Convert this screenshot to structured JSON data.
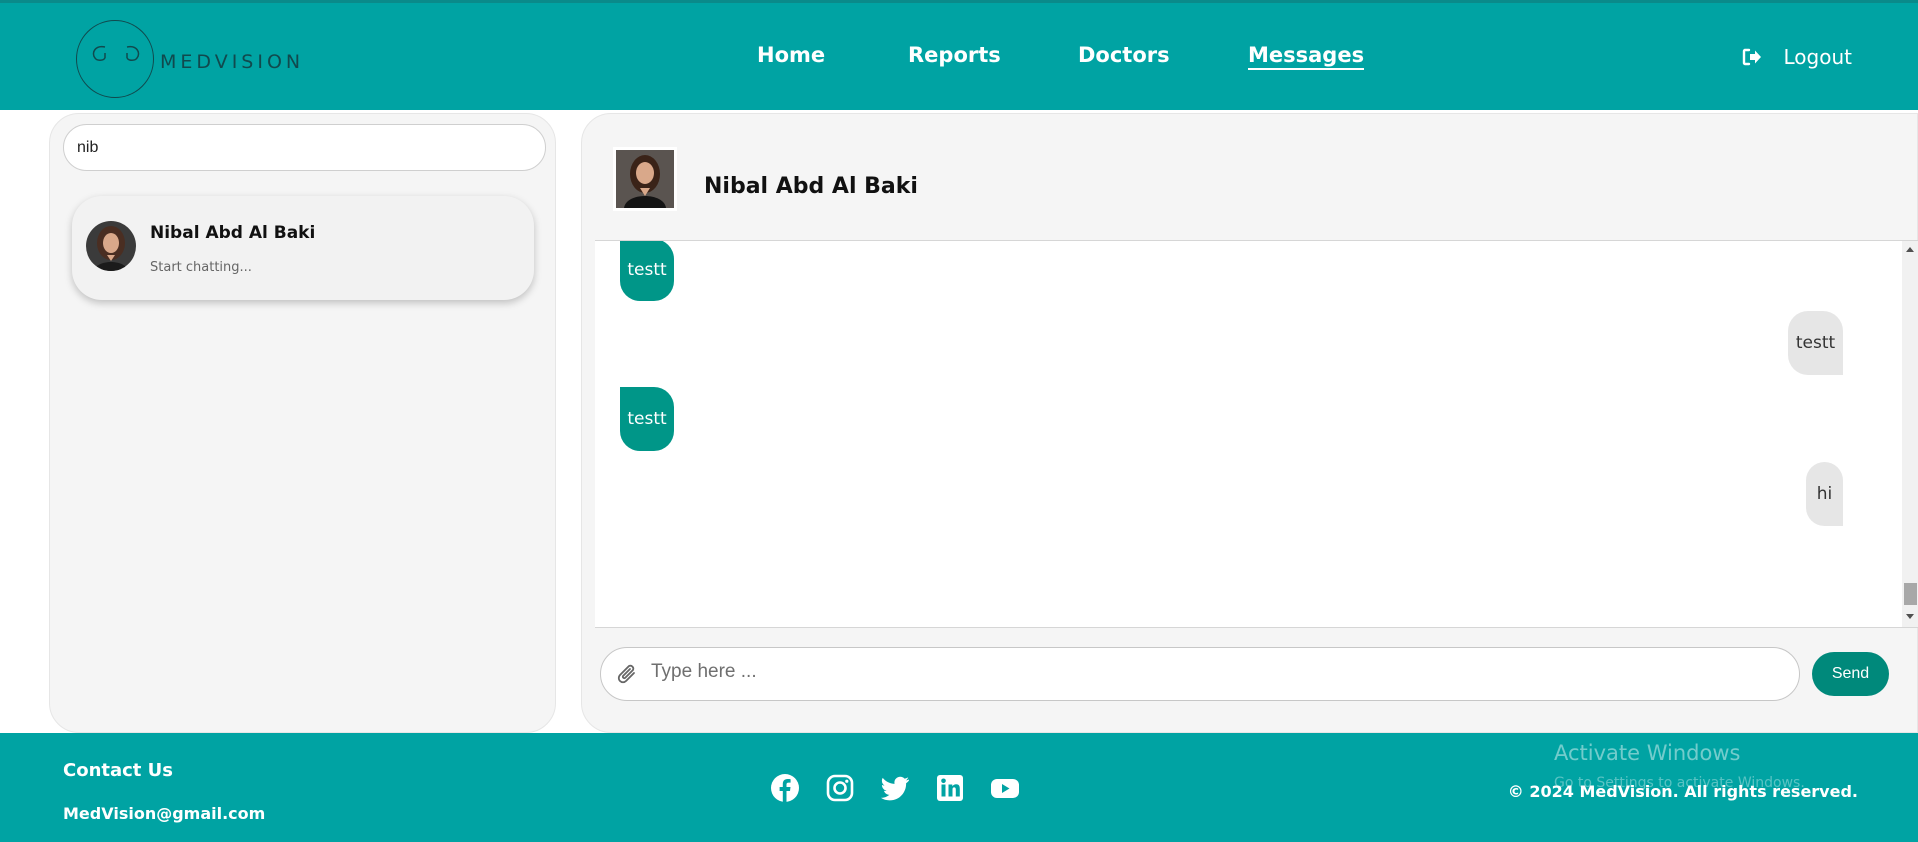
{
  "header": {
    "brand": "MEDVISION",
    "nav": [
      {
        "label": "Home"
      },
      {
        "label": "Reports"
      },
      {
        "label": "Doctors"
      },
      {
        "label": "Messages",
        "active": true
      }
    ],
    "logout_label": "Logout"
  },
  "sidebar": {
    "search": {
      "value": "nib"
    },
    "contacts": [
      {
        "name": "Nibal Abd Al Baki",
        "preview": "Start chatting..."
      }
    ]
  },
  "chat": {
    "contact_name": "Nibal Abd Al Baki",
    "messages": [
      {
        "direction": "incoming",
        "text": "testt"
      },
      {
        "direction": "outgoing",
        "text": "testt"
      },
      {
        "direction": "incoming",
        "text": "testt"
      },
      {
        "direction": "outgoing",
        "text": "hi"
      }
    ],
    "input_placeholder": "Type here ...",
    "send_label": "Send"
  },
  "footer": {
    "contact_title": "Contact Us",
    "email": "MedVision@gmail.com",
    "socials": [
      "facebook-icon",
      "instagram-icon",
      "twitter-icon",
      "linkedin-icon",
      "youtube-icon"
    ],
    "copyright": "© 2024 MedVision. All rights reserved."
  },
  "watermark": {
    "title": "Activate Windows",
    "subtitle": "Go to Settings to activate Windows."
  },
  "colors": {
    "primary": "#00a3a3",
    "incoming_bubble": "#009688",
    "outgoing_bubble": "#e6e6e6",
    "send_button": "#00897b"
  }
}
